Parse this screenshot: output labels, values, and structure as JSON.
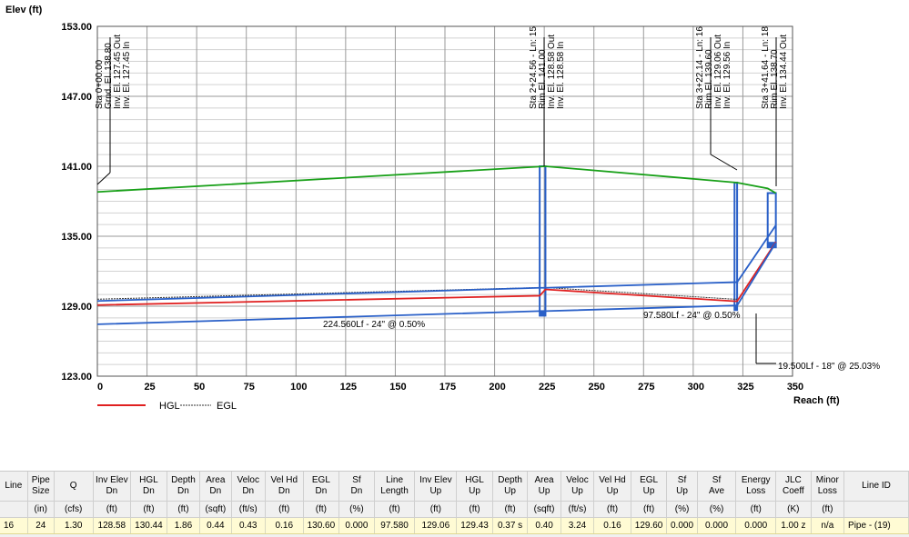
{
  "chart_data": {
    "type": "line",
    "title": "",
    "ylabel": "Elev (ft)",
    "xlabel": "Reach (ft)",
    "xlim": [
      0,
      350
    ],
    "ylim": [
      123,
      153
    ],
    "x_ticks": [
      0,
      25,
      50,
      75,
      100,
      125,
      150,
      175,
      200,
      225,
      250,
      275,
      300,
      325,
      350
    ],
    "y_tick_labels": [
      "153.00",
      "147.00",
      "141.00",
      "135.00",
      "129.00",
      "123.00"
    ],
    "y_ticks": [
      153,
      147,
      141,
      135,
      129,
      123
    ],
    "grid": true,
    "legend": {
      "items": [
        "HGL",
        "EGL"
      ],
      "position": "bottom-left"
    },
    "series": [
      {
        "name": "",
        "color": "#18a018",
        "x": [
          0,
          225.6,
          322.1,
          337.5,
          341.6
        ],
        "y": [
          138.8,
          141.0,
          139.6,
          139.1,
          138.7
        ]
      },
      {
        "name": "HGL",
        "color": "#e02020",
        "x": [
          0,
          222.7,
          225.6,
          320.8,
          322.1,
          341.6
        ],
        "y": [
          129.1,
          129.9,
          130.44,
          129.43,
          129.43,
          134.5
        ]
      },
      {
        "name": "EGL",
        "color": "#333333",
        "x": [
          0,
          222.7,
          225.6,
          320.8,
          322.1
        ],
        "y": [
          129.6,
          130.6,
          130.6,
          129.6,
          129.6
        ]
      },
      {
        "name": "",
        "color": "#2a60c8",
        "x": [
          0,
          222.7,
          225.6,
          320.8,
          322.1,
          341.6
        ],
        "y": [
          127.45,
          128.58,
          128.58,
          129.06,
          129.06,
          134.44
        ]
      },
      {
        "name": "",
        "color": "#2a60c8",
        "x": [
          0,
          222.7,
          225.6,
          320.8,
          322.1,
          341.6
        ],
        "y": [
          129.45,
          130.58,
          130.58,
          131.06,
          131.06,
          135.94
        ]
      }
    ],
    "structures": [
      {
        "station": 0,
        "label_lines": [
          "Sta 0+00.00",
          "Grnd. El. 138.80",
          "Inv. El. 127.45 Out",
          "Inv. El. 127.45 In"
        ]
      },
      {
        "station": 224.56,
        "label_lines": [
          "Sta 2+24.56 - Ln: 15",
          "Rim El. 141.00",
          "Inv. El. 128.58 Out",
          "Inv. El. 128.58 In"
        ]
      },
      {
        "station": 322.14,
        "label_lines": [
          "Sta 3+22.14 - Ln: 16",
          "Rim El. 139.60",
          "Inv. El. 129.06 Out",
          "Inv. El. 129.56 In"
        ]
      },
      {
        "station": 341.64,
        "label_lines": [
          "Sta 3+41.64 - Ln: 18",
          "Rim El. 138.70",
          "Inv. El. 134.44 Out"
        ]
      }
    ],
    "pipe_labels": [
      {
        "text": "224.560Lf - 24\" @ 0.50%"
      },
      {
        "text": "97.580Lf - 24\" @ 0.50%"
      },
      {
        "text": "19.500Lf - 18\" @ 25.03%"
      }
    ]
  },
  "table": {
    "columns": [
      {
        "h": [
          "Line"
        ],
        "u": ""
      },
      {
        "h": [
          "Pipe",
          "Size"
        ],
        "u": "(in)"
      },
      {
        "h": [
          "Q"
        ],
        "u": "(cfs)"
      },
      {
        "h": [
          "Inv Elev",
          "Dn"
        ],
        "u": "(ft)"
      },
      {
        "h": [
          "HGL",
          "Dn"
        ],
        "u": "(ft)"
      },
      {
        "h": [
          "Depth",
          "Dn"
        ],
        "u": "(ft)"
      },
      {
        "h": [
          "Area",
          "Dn"
        ],
        "u": "(sqft)"
      },
      {
        "h": [
          "Veloc",
          "Dn"
        ],
        "u": "(ft/s)"
      },
      {
        "h": [
          "Vel Hd",
          "Dn"
        ],
        "u": "(ft)"
      },
      {
        "h": [
          "EGL",
          "Dn"
        ],
        "u": "(ft)"
      },
      {
        "h": [
          "Sf",
          "Dn"
        ],
        "u": "(%)"
      },
      {
        "h": [
          "Line",
          "Length"
        ],
        "u": "(ft)"
      },
      {
        "h": [
          "Inv Elev",
          "Up"
        ],
        "u": "(ft)"
      },
      {
        "h": [
          "HGL",
          "Up"
        ],
        "u": "(ft)"
      },
      {
        "h": [
          "Depth",
          "Up"
        ],
        "u": "(ft)"
      },
      {
        "h": [
          "Area",
          "Up"
        ],
        "u": "(sqft)"
      },
      {
        "h": [
          "Veloc",
          "Up"
        ],
        "u": "(ft/s)"
      },
      {
        "h": [
          "Vel Hd",
          "Up"
        ],
        "u": "(ft)"
      },
      {
        "h": [
          "EGL",
          "Up"
        ],
        "u": "(ft)"
      },
      {
        "h": [
          "Sf",
          "Up"
        ],
        "u": "(%)"
      },
      {
        "h": [
          "Sf",
          "Ave"
        ],
        "u": "(%)"
      },
      {
        "h": [
          "Energy",
          "Loss"
        ],
        "u": "(ft)"
      },
      {
        "h": [
          "JLC",
          "Coeff"
        ],
        "u": "(K)"
      },
      {
        "h": [
          "Minor",
          "Loss"
        ],
        "u": "(ft)"
      },
      {
        "h": [
          "Line ID"
        ],
        "u": ""
      }
    ],
    "rows": [
      [
        "16",
        "24",
        "1.30",
        "128.58",
        "130.44",
        "1.86",
        "0.44",
        "0.43",
        "0.16",
        "130.60",
        "0.000",
        "97.580",
        "129.06",
        "129.43",
        "0.37 s",
        "0.40",
        "3.24",
        "0.16",
        "129.60",
        "0.000",
        "0.000",
        "0.000",
        "1.00 z",
        "n/a",
        "Pipe - (19)"
      ]
    ]
  }
}
